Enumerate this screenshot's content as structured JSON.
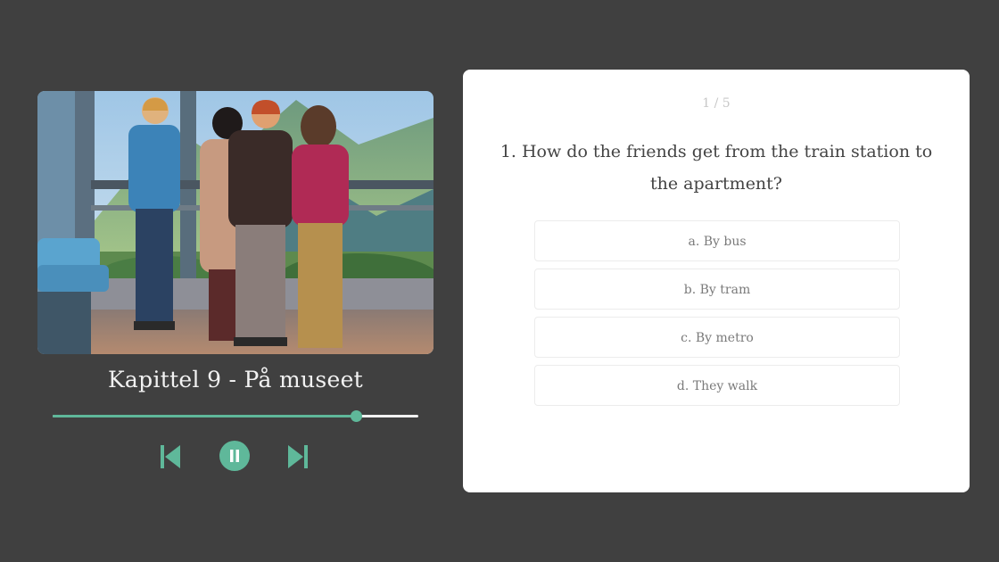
{
  "player": {
    "chapter_title": "Kapittel 9 - På museet",
    "progress_fraction": 0.83,
    "accent_color": "#5fb89a",
    "controls": {
      "prev_icon": "skip-previous-icon",
      "pause_icon": "pause-icon",
      "next_icon": "skip-next-icon"
    }
  },
  "quiz": {
    "counter": "1 / 5",
    "question": "1. How do the friends get from the train station to the apartment?",
    "options": [
      {
        "label": "a. By bus"
      },
      {
        "label": "b. By tram"
      },
      {
        "label": "c. By metro"
      },
      {
        "label": "d. They walk"
      }
    ]
  }
}
